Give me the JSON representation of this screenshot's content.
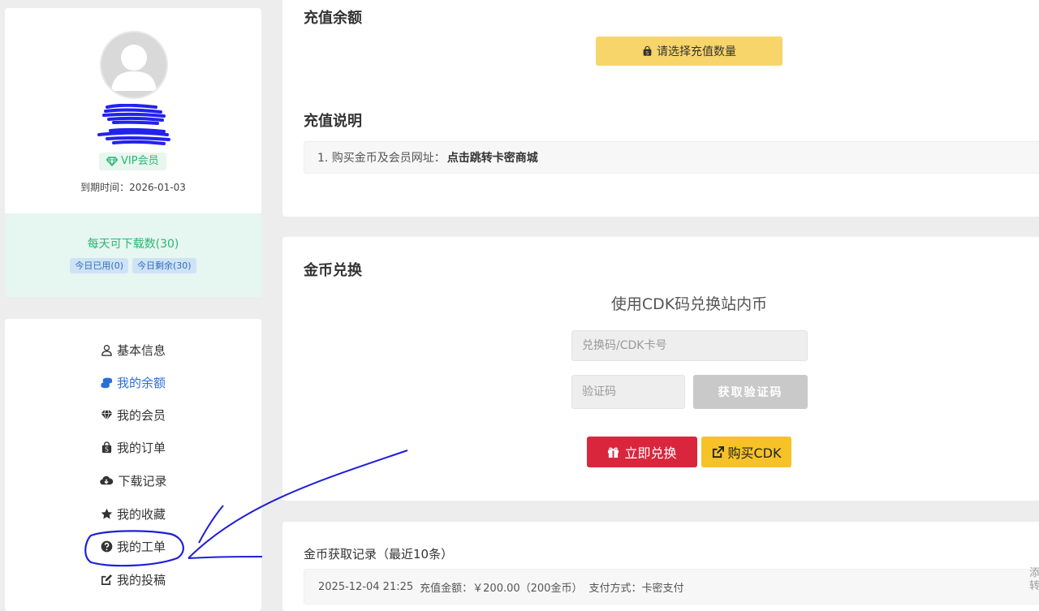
{
  "profile": {
    "vip_label": "VIP会员",
    "expiry_label": "到期时间：",
    "expiry_value": "2026-01-03",
    "download_title": "每天可下载数(30)",
    "used_today": "今日已用(0)",
    "remaining_today": "今日剩余(30)"
  },
  "menu": {
    "items": [
      {
        "label": "基本信息",
        "icon": "user-icon"
      },
      {
        "label": "我的余额",
        "icon": "coins-icon"
      },
      {
        "label": "我的会员",
        "icon": "diamond-icon"
      },
      {
        "label": "我的订单",
        "icon": "shopping-bag-icon"
      },
      {
        "label": "下载记录",
        "icon": "cloud-download-icon"
      },
      {
        "label": "我的收藏",
        "icon": "star-icon"
      },
      {
        "label": "我的工单",
        "icon": "question-circle-icon"
      },
      {
        "label": "我的投稿",
        "icon": "edit-icon"
      }
    ],
    "active_index": 1
  },
  "recharge": {
    "title": "充值余额",
    "select_button": "请选择充值数量",
    "notes_title": "充值说明",
    "note_prefix": "1. 购买金币及会员网址：",
    "note_link": "点击跳转卡密商城"
  },
  "exchange": {
    "title": "金币兑换",
    "subtitle": "使用CDK码兑换站内币",
    "code_placeholder": "兑换码/CDK卡号",
    "captcha_placeholder": "验证码",
    "captcha_button": "获取验证码",
    "redeem_button": "立即兑换",
    "buy_button": "购买CDK"
  },
  "records": {
    "title": "金币获取记录（最近10条）",
    "rows": [
      {
        "time": "2025-12-04 21:25",
        "amount": "充值金额：￥200.00（200金币）",
        "method": "支付方式：卡密支付",
        "edge": "添转"
      }
    ]
  },
  "colors": {
    "accent_blue": "#2a6fd6",
    "vip_green": "#2bb673",
    "redeem_red": "#d9263d",
    "buy_yellow": "#f6c227",
    "select_yellow": "#f8d56b",
    "annotation_ink": "#1f1fd6"
  }
}
